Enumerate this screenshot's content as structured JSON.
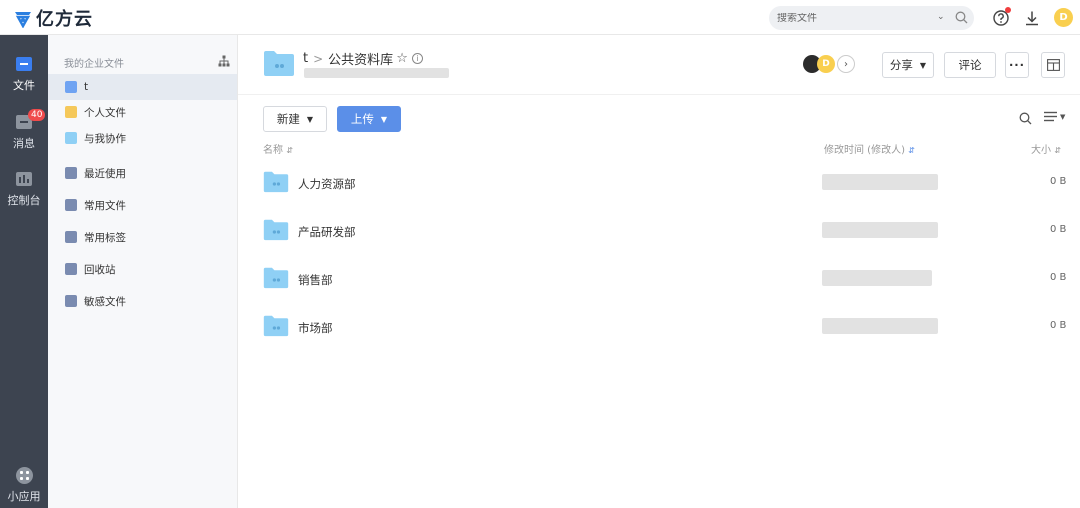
{
  "app": {
    "logo_text": "亿方云",
    "search_placeholder": "搜索文件",
    "user_initial": "D"
  },
  "rail": {
    "items": [
      {
        "label": "文件",
        "icon": "files-icon",
        "active": true
      },
      {
        "label": "消息",
        "icon": "message-icon",
        "badge": "40"
      },
      {
        "label": "控制台",
        "icon": "console-icon"
      }
    ],
    "bottom_label": "小应用"
  },
  "sidebar": {
    "header": "我的企业文件",
    "items": [
      {
        "label": "t",
        "icon": "team-folder-icon",
        "active": true
      },
      {
        "label": "个人文件",
        "icon": "personal-folder-icon"
      },
      {
        "label": "与我协作",
        "icon": "collab-folder-icon"
      },
      {
        "label": "最近使用",
        "icon": "recent-icon"
      },
      {
        "label": "常用文件",
        "icon": "star-icon"
      },
      {
        "label": "常用标签",
        "icon": "tag-icon"
      },
      {
        "label": "回收站",
        "icon": "trash-icon"
      },
      {
        "label": "敏感文件",
        "icon": "sensitive-icon"
      }
    ]
  },
  "main": {
    "breadcrumb_root": "t",
    "breadcrumb_sep": ">",
    "current_folder": "公共资料库",
    "member_initial": "D",
    "share_label": "分享",
    "comment_label": "评论",
    "new_label": "新建",
    "upload_label": "上传",
    "columns": {
      "name": "名称",
      "modified": "修改时间 (修改人)",
      "size": "大小"
    },
    "rows": [
      {
        "name": "人力资源部",
        "size": "0 B"
      },
      {
        "name": "产品研发部",
        "size": "0 B"
      },
      {
        "name": "销售部",
        "size": "0 B"
      },
      {
        "name": "市场部",
        "size": "0 B"
      }
    ]
  },
  "colors": {
    "accent": "#5b8fe8",
    "rail_bg": "#3d4450",
    "folder": "#8fd0f5",
    "badge": "#f04b4b"
  }
}
